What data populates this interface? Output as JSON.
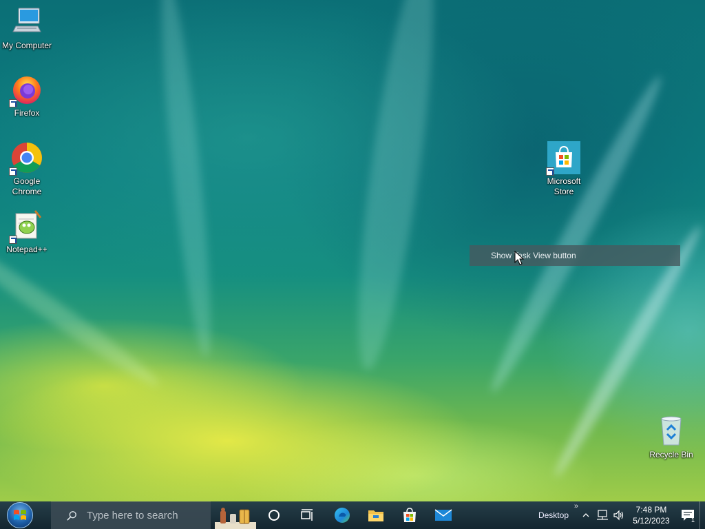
{
  "desktop": {
    "icons": [
      {
        "label": "My Computer"
      },
      {
        "label": "Firefox"
      },
      {
        "label": "Google Chrome"
      },
      {
        "label": "Notepad++"
      },
      {
        "label": "Microsoft Store"
      },
      {
        "label": "Recycle Bin"
      }
    ]
  },
  "tooltip": {
    "text": "Show Task View button"
  },
  "taskbar": {
    "search_placeholder": "Type here to search",
    "pinned": [
      "edge-icon",
      "file-explorer-icon",
      "microsoft-store-icon",
      "mail-icon"
    ],
    "tray": {
      "desktop_label": "Desktop",
      "chevron": "»",
      "time": "7:48 PM",
      "date": "5/12/2023",
      "notification_count": "1"
    }
  },
  "colors": {
    "taskbar_bg": "#1c2d36",
    "store_tile": "#2ea6c8",
    "accent_blue": "#1d5fa8"
  }
}
